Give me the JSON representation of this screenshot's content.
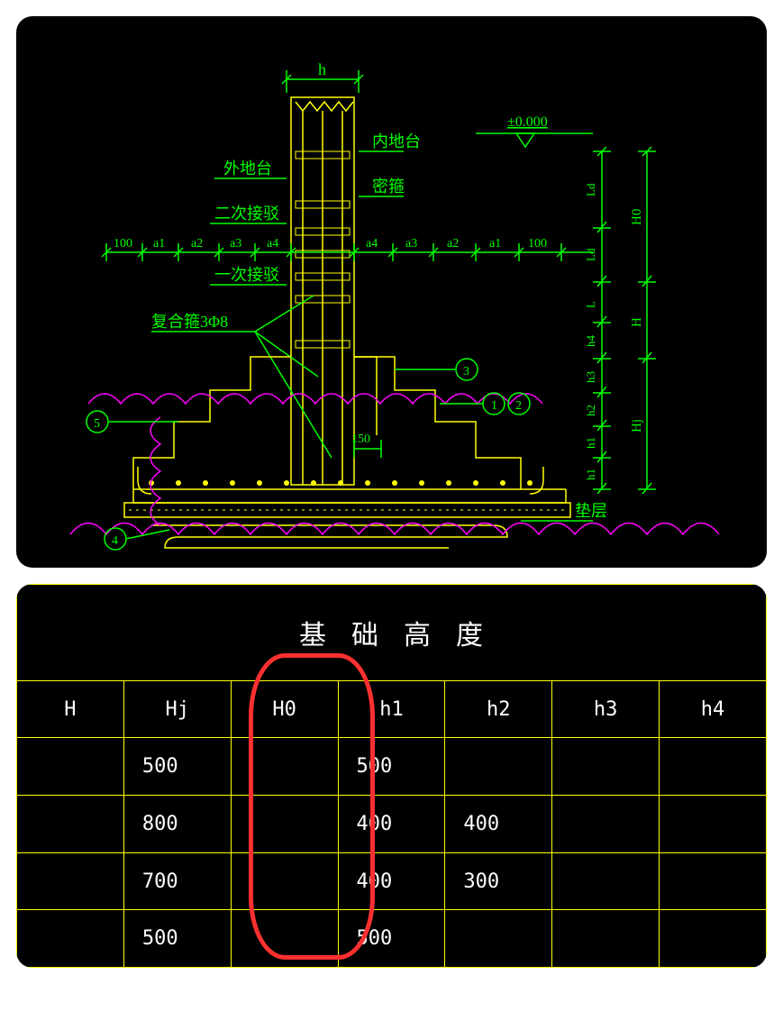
{
  "diagram": {
    "top_dim": "h",
    "datum_label": "±0.000",
    "inner_platform": "内地台",
    "outer_platform": "外地台",
    "dense_stirrup": "密箍",
    "second_splice": "二次接驳",
    "first_splice": "一次接驳",
    "comp_stirrup": "复合箍3Φ8",
    "bedding": "垫层",
    "wall_detail_dim": "150",
    "left_dims": [
      "100",
      "a1",
      "a2",
      "a3",
      "a4"
    ],
    "right_dims": [
      "a4",
      "a3",
      "a2",
      "a1",
      "100"
    ],
    "right_v_dims": [
      "Ld",
      "Ld",
      "L",
      "h4",
      "h3",
      "h2",
      "h1"
    ],
    "right_v_big": [
      "H0",
      "H",
      "Hj"
    ],
    "bubbles": [
      "1",
      "2",
      "3",
      "4",
      "5"
    ]
  },
  "table": {
    "title": "基础高度",
    "headers": [
      "H",
      "Hj",
      "H0",
      "h1",
      "h2",
      "h3",
      "h4"
    ],
    "rows": [
      [
        "",
        "500",
        "",
        "500",
        "",
        "",
        ""
      ],
      [
        "",
        "800",
        "",
        "400",
        "400",
        "",
        ""
      ],
      [
        "",
        "700",
        "",
        "400",
        "300",
        "",
        ""
      ],
      [
        "",
        "500",
        "",
        "500",
        "",
        "",
        ""
      ]
    ]
  },
  "chart_data": {
    "type": "table",
    "title": "基础高度",
    "columns": [
      "H",
      "Hj",
      "H0",
      "h1",
      "h2",
      "h3",
      "h4"
    ],
    "rows": [
      {
        "H": null,
        "Hj": 500,
        "H0": null,
        "h1": 500,
        "h2": null,
        "h3": null,
        "h4": null
      },
      {
        "H": null,
        "Hj": 800,
        "H0": null,
        "h1": 400,
        "h2": 400,
        "h3": null,
        "h4": null
      },
      {
        "H": null,
        "Hj": 700,
        "H0": null,
        "h1": 400,
        "h2": 300,
        "h3": null,
        "h4": null
      },
      {
        "H": null,
        "Hj": 500,
        "H0": null,
        "h1": 500,
        "h2": null,
        "h3": null,
        "h4": null
      }
    ],
    "annotation": "H0 column circled in red"
  }
}
